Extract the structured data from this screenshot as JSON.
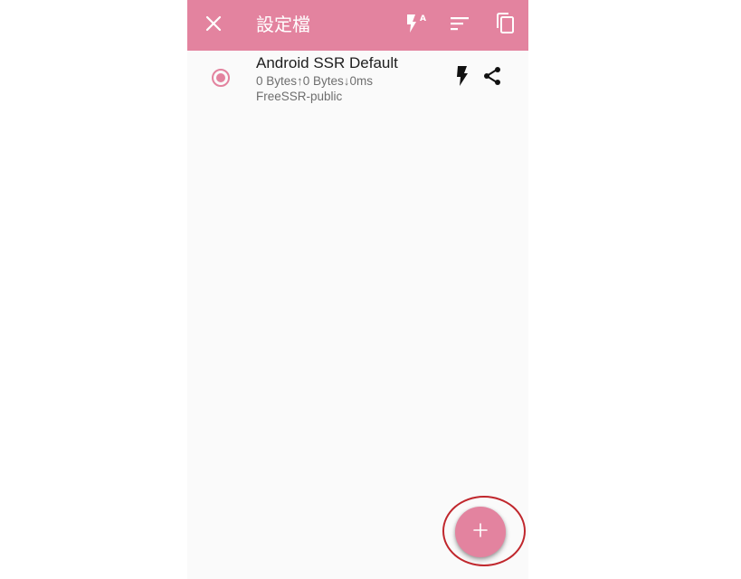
{
  "toolbar": {
    "title": "設定檔",
    "close_icon": "close-icon",
    "test_icon": "flash-auto-icon",
    "sort_icon": "sort-icon",
    "copy_icon": "content-copy-icon",
    "background_color": "#e3839f"
  },
  "profiles": [
    {
      "name": "Android SSR Default",
      "stats": "0 Bytes↑0 Bytes↓0ms",
      "group": "FreeSSR-public",
      "selected": true,
      "test_icon": "flash-icon",
      "share_icon": "share-icon"
    }
  ],
  "fab": {
    "label": "+",
    "icon": "add-icon",
    "color": "#e3839f"
  },
  "annotation": {
    "ring_color": "#c0272d"
  }
}
